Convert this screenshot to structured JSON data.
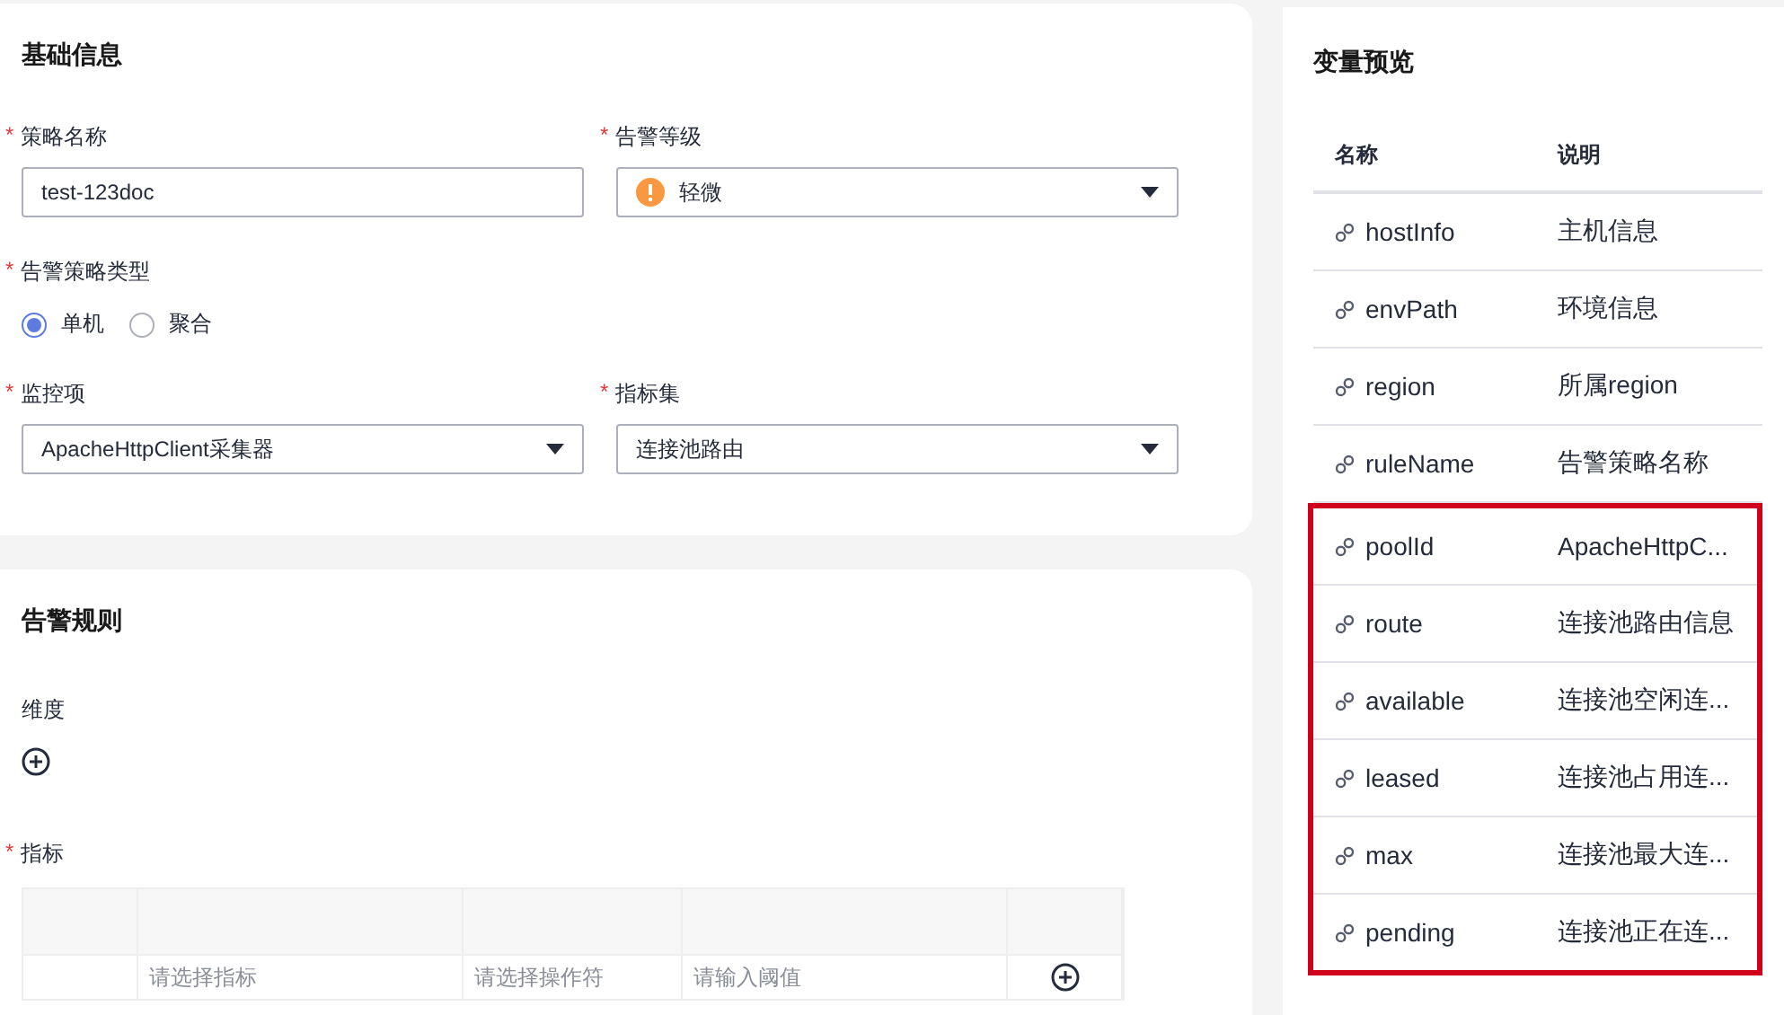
{
  "basic_info": {
    "title": "基础信息",
    "fields": [
      {
        "kind": "input",
        "label": "策略名称",
        "required_mark": "*",
        "value": "test-123doc"
      },
      {
        "kind": "select",
        "label": "告警等级",
        "required_mark": "*",
        "value": "轻微",
        "warning": true
      },
      {
        "kind": "radio",
        "label": "告警策略类型",
        "required_mark": "*",
        "options": [
          {
            "label": "单机",
            "selected": true
          },
          {
            "label": "聚合",
            "selected": false
          }
        ]
      },
      {
        "kind": "select",
        "label": "监控项",
        "required_mark": "*",
        "value": "ApacheHttpClient采集器"
      },
      {
        "kind": "select",
        "label": "指标集",
        "required_mark": "*",
        "value": "连接池路由"
      }
    ]
  },
  "alarm_rules": {
    "title": "告警规则",
    "dimension_label": "维度",
    "metric_label": "指标",
    "metric_required_mark": "*",
    "row": {
      "metric_placeholder": "请选择指标",
      "operator_placeholder": "请选择操作符",
      "threshold_placeholder": "请输入阈值"
    }
  },
  "variable_preview": {
    "title": "变量预览",
    "columns": [
      "名称",
      "说明"
    ],
    "rows": [
      {
        "name": "hostInfo",
        "description": "主机信息"
      },
      {
        "name": "envPath",
        "description": "环境信息"
      },
      {
        "name": "region",
        "description": "所属region"
      },
      {
        "name": "ruleName",
        "description": "告警策略名称"
      }
    ],
    "highlighted_rows": [
      {
        "name": "poolId",
        "description": "ApacheHttpC..."
      },
      {
        "name": "route",
        "description": "连接池路由信息"
      },
      {
        "name": "available",
        "description": "连接池空闲连..."
      },
      {
        "name": "leased",
        "description": "连接池占用连..."
      },
      {
        "name": "max",
        "description": "连接池最大连..."
      },
      {
        "name": "pending",
        "description": "连接池正在连..."
      }
    ]
  }
}
